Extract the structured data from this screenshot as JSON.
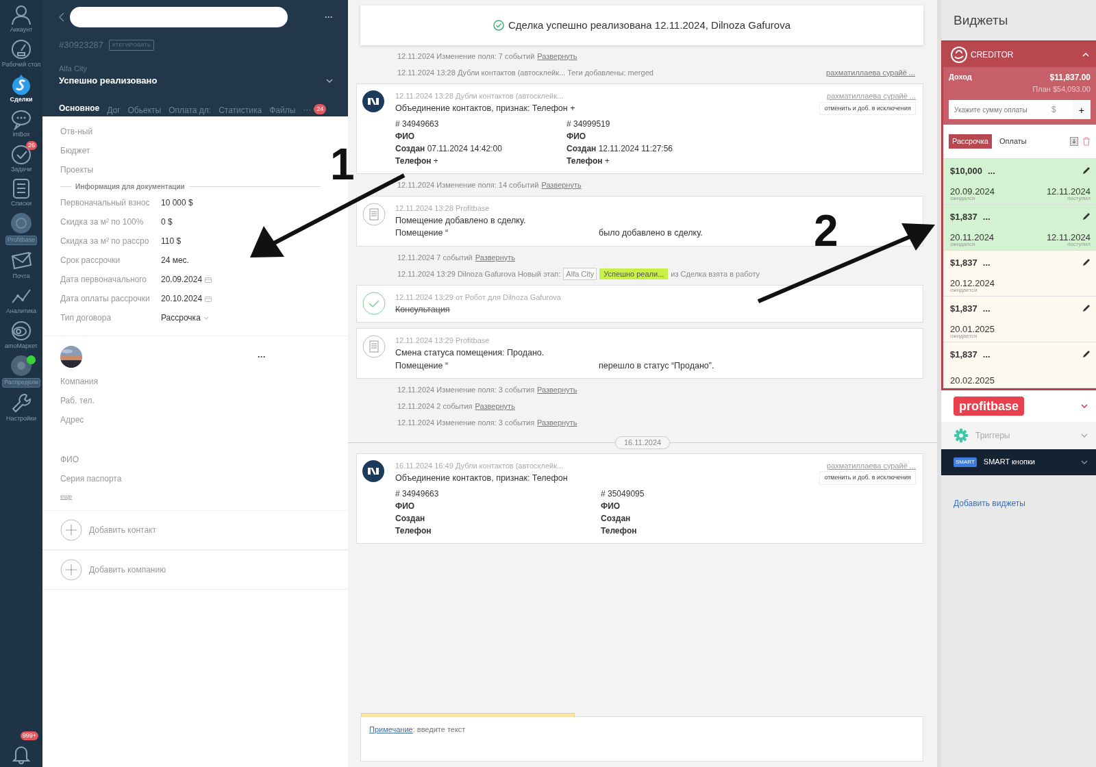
{
  "nav": {
    "items": [
      {
        "label": "Аккаунт",
        "kind": "plain",
        "selected": false,
        "online": false
      },
      {
        "label": "Рабочий стол",
        "kind": "plain",
        "selected": false,
        "online": false
      },
      {
        "label": "Сделки",
        "kind": "plain",
        "selected": true,
        "online": false
      },
      {
        "label": "imBox",
        "kind": "plain",
        "selected": false,
        "online": false
      },
      {
        "label": "Задачи",
        "kind": "plain",
        "selected": false,
        "online": false,
        "badge": "26"
      },
      {
        "label": "Списки",
        "kind": "plain",
        "selected": false,
        "online": false
      },
      {
        "label": "Profitbase",
        "kind": "tag",
        "selected": false,
        "online": false
      },
      {
        "label": "Почта",
        "kind": "plain",
        "selected": false,
        "online": false
      },
      {
        "label": "Аналитика",
        "kind": "plain",
        "selected": false,
        "online": false
      },
      {
        "label": "amoМаркет",
        "kind": "plain",
        "selected": false,
        "online": false
      },
      {
        "label": "Распредели",
        "kind": "tag",
        "selected": false,
        "online": true
      },
      {
        "label": "Настройки",
        "kind": "plain",
        "selected": false,
        "online": false
      }
    ],
    "notifications": {
      "badge": "999+"
    }
  },
  "deal": {
    "more_menu": "···",
    "id": "#30923287",
    "tag_button": "#ТЕГИРОВАТЬ",
    "pipeline": "Alfa City",
    "stage": "Успешно реализовано",
    "tabs": [
      {
        "label": "Основное",
        "selected": true
      },
      {
        "label": "Дог",
        "selected": false
      },
      {
        "label": "Обьекты",
        "selected": false
      },
      {
        "label": "Оплата дл:",
        "selected": false
      },
      {
        "label": "Статистика",
        "selected": false
      },
      {
        "label": "Файлы",
        "selected": false
      }
    ],
    "tabs_more": "···",
    "tabs_badge": "24",
    "fields": [
      {
        "label": "Отв-ный"
      },
      {
        "label": "Бюджет"
      },
      {
        "label": "Проекты"
      }
    ],
    "section": "Информация для документации",
    "doc_fields": [
      {
        "label": "Первоначальный взнос",
        "value": "10 000 $",
        "kind": "text"
      },
      {
        "label": "Скидка за м² по 100%",
        "value": "0 $",
        "kind": "text"
      },
      {
        "label": "Скидка за м² по рассро",
        "value": "110 $",
        "kind": "text"
      },
      {
        "label": "Срок рассрочки",
        "value": "24 мес.",
        "kind": "text"
      },
      {
        "label": "Дата первоначального",
        "value": "20.09.2024",
        "kind": "date"
      },
      {
        "label": "Дата оплаты рассрочки",
        "value": "20.10.2024",
        "kind": "date"
      },
      {
        "label": "Тип договора",
        "value": "Рассрочка",
        "kind": "select"
      }
    ],
    "contact": {
      "more_menu": "···",
      "fields": [
        {
          "label": "Компания"
        },
        {
          "label": "Раб. тел."
        },
        {
          "label": "Адрес"
        }
      ],
      "fields2": [
        {
          "label": "ФИО"
        },
        {
          "label": "Серия паспорта"
        }
      ],
      "more": "еще"
    },
    "add_buttons": [
      "Добавить контакт",
      "Добавить компанию"
    ]
  },
  "feed": {
    "banner": "Сделка успешно реализована 12.11.2024, Dilnoza Gafurova",
    "events": [
      {
        "kind": "line",
        "text": "12.11.2024 Изменение поля: 7 событий",
        "link": "Развернуть"
      },
      {
        "kind": "line",
        "text": "12.11.2024 13:28 Дубли контактов (автосклейк... Теги добавлены: merged",
        "author": "рахматиллаева сурайё ..."
      },
      {
        "kind": "merge",
        "meta": "12.11.2024 13:28 Дубли контактов (автосклейк...",
        "author": "рахматиллаева сурайё ...",
        "action": "отменить и доб. в исключения",
        "title": "Объединение контактов, признак: Телефон +",
        "columns": [
          {
            "id": "# 34949663",
            "rows": [
              {
                "label": "ФИО"
              },
              {
                "label": "Создан",
                "value": "07.11.2024 14:42:00"
              },
              {
                "label": "Телефон",
                "value": "+"
              }
            ]
          },
          {
            "id": "# 34999519",
            "rows": [
              {
                "label": "ФИО"
              },
              {
                "label": "Создан",
                "value": "12.11.2024 11:27:56"
              },
              {
                "label": "Телефон",
                "value": "+"
              }
            ]
          }
        ]
      },
      {
        "kind": "line",
        "text": "12.11.2024 Изменение поля: 14 событий",
        "link": "Развернуть"
      },
      {
        "kind": "doc",
        "meta": "12.11.2024 13:28 Profitbase",
        "lines": [
          {
            "text": "Помещение добавлено в сделку."
          },
          {
            "text": "Помещение “",
            "tail": "было добавлено в сделку."
          }
        ]
      },
      {
        "kind": "line",
        "text": "12.11.2024 7 событий",
        "link": "Развернуть"
      },
      {
        "kind": "stage",
        "text": "12.11.2024 13:29 Dilnoza Gafurova Новый этап:",
        "pipeline": "Alfa City",
        "stage": "Успешно реали...",
        "tail": "из Сделка взята в работу"
      },
      {
        "kind": "task",
        "meta": "12.11.2024 13:29  от Робот для Dilnoza Gafurova",
        "text": "Консультация",
        "done": true
      },
      {
        "kind": "doc",
        "meta": "12.11.2024 13:29 Profitbase",
        "lines": [
          {
            "text": "Смена статуса помещения: Продано."
          },
          {
            "text": "Помещение “",
            "tail": "перешло в статус “Продано”."
          }
        ]
      },
      {
        "kind": "line",
        "text": "12.11.2024 Изменение поля: 3 события",
        "link": "Развернуть"
      },
      {
        "kind": "line",
        "text": "12.11.2024 2 события",
        "link": "Развернуть"
      },
      {
        "kind": "line",
        "text": "12.11.2024 Изменение поля: 3 события",
        "link": "Развернуть"
      },
      {
        "kind": "date",
        "text": "16.11.2024"
      },
      {
        "kind": "merge",
        "meta": "16.11.2024 16:49 Дубли контактов (автосклейк...",
        "author": "рахматиллаева сурайё ...",
        "action": "отменить и доб. в исключения",
        "title": "Объединение контактов, признак: Телефон",
        "columns": [
          {
            "id": "# 34949663",
            "rows": [
              {
                "label": "ФИО"
              },
              {
                "label": "Создан"
              },
              {
                "label": "Телефон"
              }
            ]
          },
          {
            "id": "# 35049095",
            "rows": [
              {
                "label": "ФИО"
              },
              {
                "label": "Создан"
              },
              {
                "label": "Телефон"
              }
            ]
          }
        ]
      }
    ],
    "note": {
      "label": "Примечание",
      "placeholder": ": введите текст"
    }
  },
  "widgets": {
    "title": "Виджеты",
    "creditor": {
      "name": "CREDITOR",
      "income_label": "Доход",
      "income": "$11,837.00",
      "plan": "План $54,093.00",
      "input_placeholder": "Укажите сумму оплаты",
      "currency": "$",
      "add": "+",
      "tabs": [
        {
          "label": "Рассрочка",
          "selected": true
        },
        {
          "label": "Оплаты",
          "selected": false
        }
      ],
      "payments": [
        {
          "amount": "$10,000",
          "more": "...",
          "due": "20.09.2024",
          "due_label": "ожидался",
          "paid": true,
          "received": "12.11.2024",
          "received_label": "поступил"
        },
        {
          "amount": "$1,837",
          "more": "...",
          "due": "20.11.2024",
          "due_label": "ожидался",
          "paid": true,
          "received": "12.11.2024",
          "received_label": "поступил"
        },
        {
          "amount": "$1,837",
          "more": "...",
          "due": "20.12.2024",
          "due_label": "ожидается",
          "paid": false
        },
        {
          "amount": "$1,837",
          "more": "...",
          "due": "20.01.2025",
          "due_label": "ожидается",
          "paid": false
        },
        {
          "amount": "$1,837",
          "more": "...",
          "due": "20.02.2025",
          "paid": false
        }
      ]
    },
    "profitbase": {
      "logo": "profitbase"
    },
    "triggers": {
      "label": "Триггеры"
    },
    "smart": {
      "badge": "SMART",
      "label": "SMART кнопки"
    },
    "add_link": "Добавить виджеты"
  },
  "annotations": [
    {
      "label": "1"
    },
    {
      "label": "2"
    }
  ]
}
